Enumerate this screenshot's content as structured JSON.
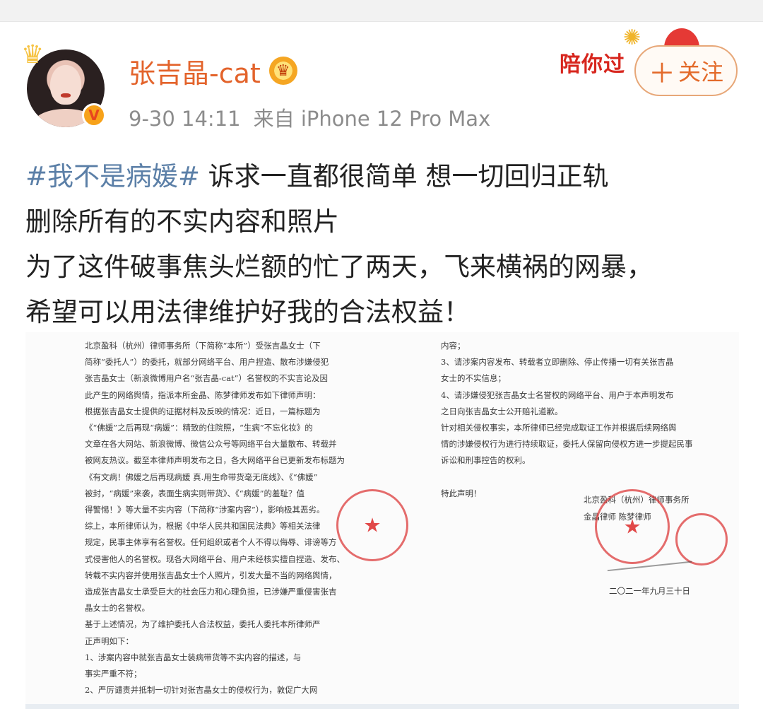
{
  "post": {
    "username": "张吉晶-cat",
    "timestamp": "9-30 14:11",
    "source": "来自 iPhone 12 Pro Max",
    "follow_label": "关注",
    "follow_plus": "＋",
    "festival_text": "陪你过",
    "text": {
      "hashtag": "#我不是病媛#",
      "line1_rest": " 诉求一直都很简单 想一切回归正轨",
      "line2": "删除所有的不实内容和照片",
      "line3": "为了这件破事焦头烂额的忙了两天，飞来横祸的网暴，",
      "line4": "希望可以用法律维护好我的合法权益！"
    }
  },
  "document": {
    "left_lines": [
      "北京盈科（杭州）律师事务所（下简称“本所”）受张吉晶女士（下",
      "简称“委托人”）的委托，就部分网络平台、用户捏造、散布涉嫌侵犯",
      "张吉晶女士（新浪微博用户名“张吉晶-cat”）名誉权的不实言论及因",
      "此产生的网络舆情，指派本所金晶、陈梦律师发布如下律师声明：",
      "根据张吉晶女士提供的证据材料及反映的情况：近日，一篇标题为",
      "《“佛媛”之后再现“病媛”：精致的住院照，“生病”不忘化妆》的",
      "文章在各大网站、新浪微博、微信公众号等网络平台大量散布、转载并",
      "被网友热议。截至本律师声明发布之日，各大网络平台已更新发布标题为",
      "《有文病！佛媛之后再现病媛 真.用生命带货毫无底线》、《“佛媛”",
      "被封，“病媛”来袭，表面生病实则带货》、《“病媛”的羞耻？值",
      "得警惕！》等大量不实内容（下简称“涉案内容”），影响极其恶劣。",
      "综上，本所律师认为，根据《中华人民共和国民法典》等相关法律",
      "规定，民事主体享有名誉权。任何组织或者个人不得以侮辱、诽谤等方",
      "式侵害他人的名誉权。现各大网络平台、用户未经核实擅自捏造、发布、",
      "转载不实内容并使用张吉晶女士个人照片，引发大量不当的网络舆情，",
      "造成张吉晶女士承受巨大的社会压力和心理负担，已涉嫌严重侵害张吉",
      "晶女士的名誉权。",
      "基于上述情况，为了维护委托人合法权益，委托人委托本所律师严",
      "正声明如下：",
      "1、涉案内容中就张吉晶女士装病带货等不实内容的描述，与",
      "事实严重不符；",
      "2、严厉谴责并抵制一切针对张吉晶女士的侵权行为，敦促广大网"
    ],
    "right_lines": [
      "内容；",
      "3、请涉案内容发布、转载者立即删除、停止传播一切有关张吉晶",
      "女士的不实信息；",
      "4、请涉嫌侵犯张吉晶女士名誉权的网络平台、用户于本声明发布",
      "之日向张吉晶女士公开赔礼道歉。",
      "针对相关侵权事实，本所律师已经完成取证工作并根据后续网络舆",
      "情的涉嫌侵权行为进行持续取证，委托人保留向侵权方进一步提起民事",
      "诉讼和刑事控告的权利。",
      "",
      "特此声明！"
    ],
    "sign_lines": [
      "北京盈科（杭州）律师事务所",
      "金晶律师  陈梦律师"
    ],
    "date": "二〇二一年九月三十日",
    "seal_color": "#dc3c3c"
  }
}
